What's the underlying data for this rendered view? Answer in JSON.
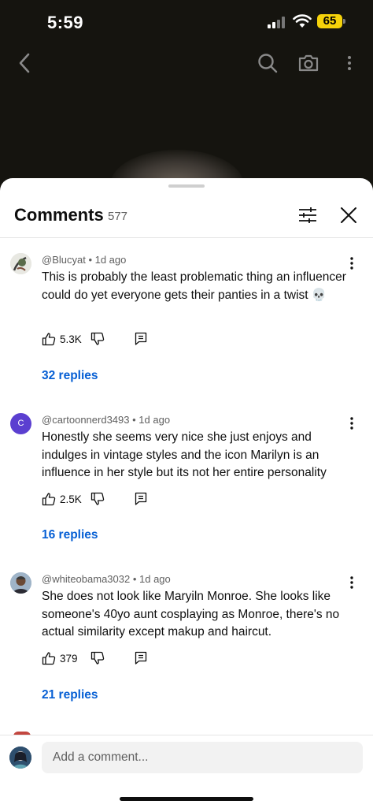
{
  "status_bar": {
    "time": "5:59",
    "battery": "65"
  },
  "video_controls": {
    "back_icon": "chevron-left-icon",
    "search_icon": "search-icon",
    "camera_icon": "camera-icon",
    "menu_icon": "more-vertical-icon"
  },
  "comments_panel": {
    "title": "Comments",
    "count": "577",
    "filter_icon": "sliders-icon",
    "close_icon": "close-icon"
  },
  "comments": [
    {
      "author": "@Blucyat",
      "time": "1d ago",
      "text": "This is probably the least problematic thing an influencer could do yet everyone  gets their panties in a twist 💀",
      "likes": "5.3K",
      "replies": "32 replies",
      "avatar_letter": ""
    },
    {
      "author": "@cartoonnerd3493",
      "time": "1d ago",
      "text": "Honestly she seems very nice she just enjoys and indulges in vintage styles and the icon Marilyn is an influence in her style but its not her entire personality",
      "likes": "2.5K",
      "replies": "16 replies",
      "avatar_letter": "C"
    },
    {
      "author": "@whiteobama3032",
      "time": "1d ago",
      "text": "She does not look like Maryiln Monroe. She looks like someone's 40yo aunt cosplaying as Monroe, there's no actual similarity except makup and haircut.",
      "likes": "379",
      "replies": "21 replies",
      "avatar_letter": ""
    }
  ],
  "composer": {
    "placeholder": "Add a comment..."
  },
  "colors": {
    "link": "#065fd4",
    "sheet_bg": "#ffffff",
    "video_bg": "#15140f",
    "battery": "#f5d20a",
    "avatar_purple": "#5b3fd0"
  }
}
